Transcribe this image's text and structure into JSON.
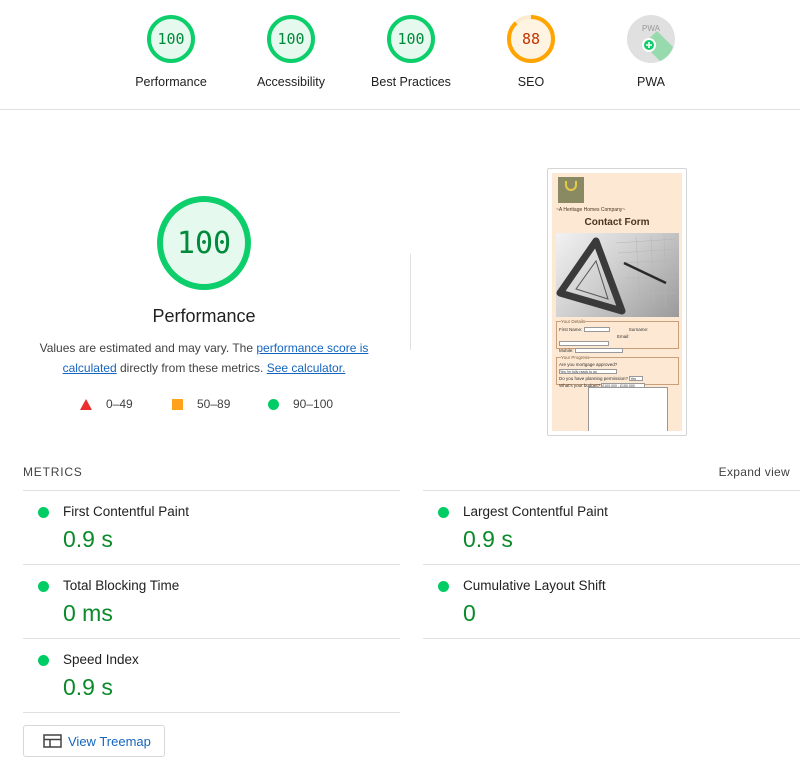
{
  "colors": {
    "pass": "#0cce6b",
    "pass_fill": "#e6f9ee",
    "pass_text": "#008a3a",
    "average": "#ffa400",
    "average_fill": "#fff4e2",
    "average_text": "#c33300",
    "na": "#cccccc",
    "fail": "#eb2f2f",
    "link": "#1565c0"
  },
  "gauges": [
    {
      "label": "Performance",
      "score": "100",
      "fraction": 1.0,
      "status": "pass"
    },
    {
      "label": "Accessibility",
      "score": "100",
      "fraction": 1.0,
      "status": "pass"
    },
    {
      "label": "Best Practices",
      "score": "100",
      "fraction": 1.0,
      "status": "pass"
    },
    {
      "label": "SEO",
      "score": "88",
      "fraction": 0.88,
      "status": "average"
    },
    {
      "label": "PWA",
      "score": "PWA",
      "fraction": 0,
      "status": "na"
    }
  ],
  "summary": {
    "score": "100",
    "fraction": 1.0,
    "title": "Performance",
    "desc_prefix": "Values are estimated and may vary. The ",
    "desc_link1": "performance score is calculated",
    "desc_middle": " directly from these metrics. ",
    "desc_link2": "See calculator."
  },
  "legend": [
    {
      "icon": "fail-triangle-icon",
      "range": "0–49"
    },
    {
      "icon": "average-square-icon",
      "range": "50–89"
    },
    {
      "icon": "pass-circle-icon",
      "range": "90–100"
    }
  ],
  "thumbnail": {
    "company": "~A Heritage Homes Company~",
    "title": "Contact Form",
    "details_caption": "Your Details",
    "first_name": "First Name:",
    "surname": "Surname:",
    "email": "Email:",
    "mobile": "Mobile:",
    "progress_caption": "Your Progress",
    "q1": "Are you mortgage approved?",
    "q1_answer": "Yes I'm fully ready to go",
    "q2": "Do you have planning permission?",
    "q2_answer": "Yes",
    "q3": "What's your budget?",
    "q3_answer": "£100,000 - £150,000"
  },
  "metrics": {
    "heading": "METRICS",
    "expand_label": "Expand view",
    "left": [
      {
        "name": "First Contentful Paint",
        "value": "0.9 s"
      },
      {
        "name": "Total Blocking Time",
        "value": "0 ms"
      },
      {
        "name": "Speed Index",
        "value": "0.9 s"
      }
    ],
    "right": [
      {
        "name": "Largest Contentful Paint",
        "value": "0.9 s"
      },
      {
        "name": "Cumulative Layout Shift",
        "value": "0"
      }
    ]
  },
  "treemap": {
    "label": "View Treemap",
    "icon": "treemap-icon"
  }
}
